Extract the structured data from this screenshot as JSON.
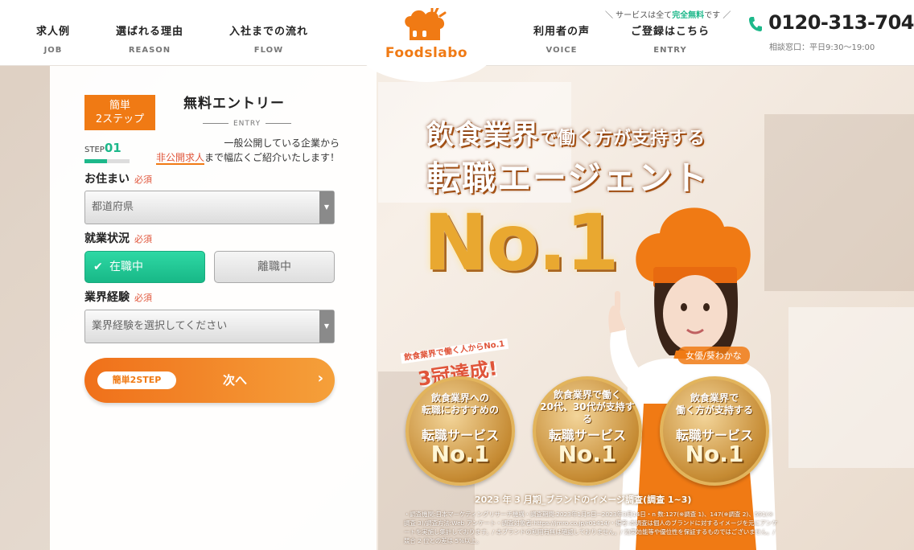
{
  "header": {
    "nav_left": [
      {
        "ja": "求人例",
        "en": "JOB"
      },
      {
        "ja": "選ばれる理由",
        "en": "REASON"
      },
      {
        "ja": "入社までの流れ",
        "en": "FLOW"
      }
    ],
    "logo_text": "Foodslabo",
    "nav_right": [
      {
        "ja": "利用者の声",
        "en": "VOICE"
      },
      {
        "ja": "ご登録はこちら",
        "en": "ENTRY"
      }
    ],
    "entry_note_prefix": "＼ サービスは全て",
    "entry_note_free": "完全無料",
    "entry_note_suffix": "です ／",
    "phone_number": "0120-313-704",
    "phone_hours": "相談窓口：平日9:30〜19:00",
    "accent_color": "#f07a14",
    "green_color": "#1db88a"
  },
  "form": {
    "badge": "簡単\n2ステップ",
    "badge_line1": "簡単",
    "badge_line2": "2ステップ",
    "title": "無料エントリー",
    "subtitle": "ENTRY",
    "desc_line1": "一般公開している企業から",
    "desc_highlight": "非公開求人",
    "desc_line2": "まで幅広くご紹介いたします！",
    "step_prefix": "STEP",
    "step_number": "01",
    "step_progress": 0.5,
    "residence_label": "お住まい",
    "required": "必須",
    "residence_placeholder": "都道府県",
    "status_label": "就業状況",
    "status_options": [
      "在職中",
      "離職中"
    ],
    "status_selected": "在職中",
    "experience_label": "業界経験",
    "experience_placeholder": "業界経験を選択してください",
    "next_pill": "簡単2STEP",
    "next_label": "次へ"
  },
  "hero": {
    "headline1_a": "飲食業界",
    "headline1_b": "で働く方が支持する",
    "headline2": "転職エージェント",
    "no1": "No.1",
    "actor_caption": "女優/葵わかな",
    "triple_top": "飲食業界で働く人からNo.1",
    "triple_main": "3冠達成!",
    "medals": [
      {
        "top": "飲食業界への\n転職におすすめの",
        "top1": "飲食業界への",
        "top2": "転職におすすめの",
        "mid": "転職サービス",
        "no1": "No.1"
      },
      {
        "top": "飲食業界で働く\n20代、30代が\n支持する",
        "top1": "飲食業界で働く",
        "top2": "20代、30代が支持する",
        "mid": "転職サービス",
        "no1": "No.1"
      },
      {
        "top": "飲食業界で\n働く方が支持する",
        "top1": "飲食業界で",
        "top2": "働く方が支持する",
        "mid": "転職サービス",
        "no1": "No.1"
      }
    ],
    "survey": "2023 年 3 月期_ブランドのイメージ調査(調査 1~3)",
    "fineprint": "・調査機関:日本マーケティングリサーチ機構・調査期間:2023年1月5日~2023年3月14日・n 数:127(※調査 1)、147(※調査 2)、591(※調査 3)/調査方法:Web アンケート・調査対象者:https://jmro.co.jp/r01414/・備考:本調査は個人のブランドに対するイメージを元にアンケートを実施し集計しております。/ 本ブランドの利用有無は確認しておりません。/ 効果効能等や優位性を保証するものではございません。/ 競合 2 位との差は 5%以上。"
  }
}
